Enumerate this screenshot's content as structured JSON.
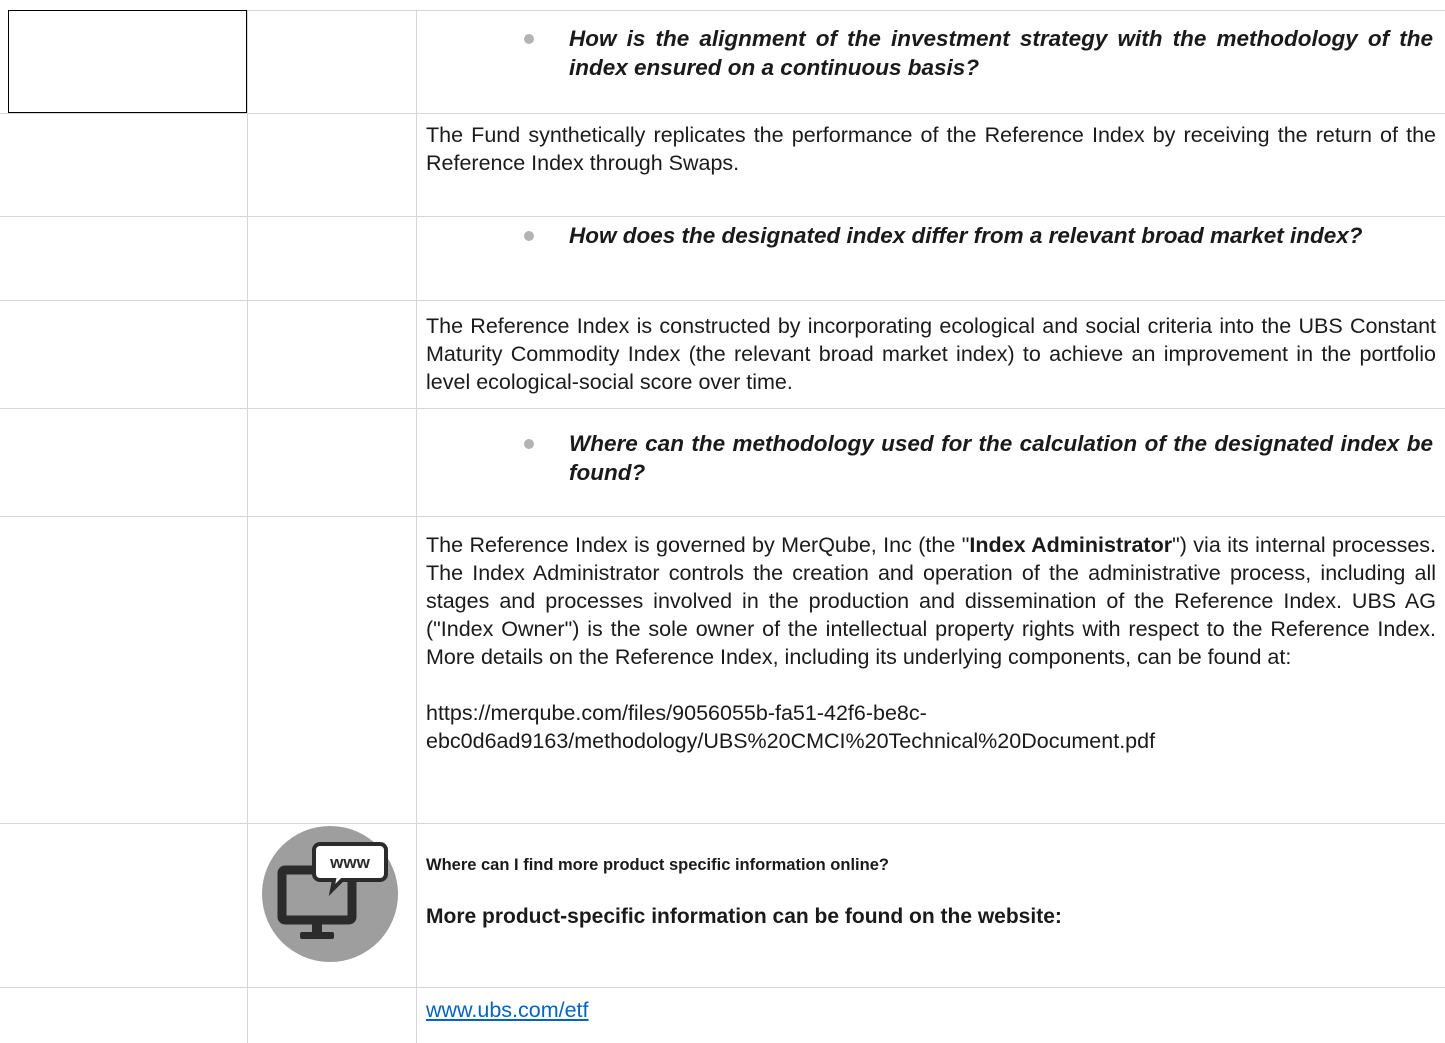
{
  "sections": [
    {
      "question": "How is the alignment of the investment strategy with the methodology of the index ensured on a continuous basis?",
      "answer": "The Fund synthetically replicates the performance of the Reference Index by receiving the return of the Reference Index through Swaps."
    },
    {
      "question": "How does the designated index differ from a relevant broad market index?",
      "answer": "The Reference Index is constructed by incorporating ecological and social criteria into the UBS Constant Maturity Commodity Index (the relevant broad market index) to achieve an improvement in the portfolio level ecological-social score over time."
    },
    {
      "question": "Where can the methodology used for the calculation of the designated index be found?",
      "answer_part1": "The Reference Index is governed by MerQube, Inc (the \"",
      "answer_bold": "Index Administrator",
      "answer_part2": "\") via its internal processes. The Index Administrator controls the creation and operation of the administrative process, including all stages and processes involved in the production and dissemination of the Reference Index. UBS AG (\"Index Owner\") is the sole owner of the intellectual property rights with respect to the Reference Index. More details on the Reference Index, including its underlying components, can be found at:",
      "url_line1": "https://merqube.com/files/9056055b-fa51-42f6-be8c-",
      "url_line2": "ebc0d6ad9163/methodology/UBS%20CMCI%20Technical%20Document.pdf"
    }
  ],
  "online_info": {
    "icon": "www-monitor-icon",
    "icon_label": "www",
    "heading": "Where can I find more product specific information online?",
    "subheading": "More product-specific information can be found on the website:",
    "link_text": "www.ubs.com/etf"
  },
  "colors": {
    "grid": "#d6d6d6",
    "bullet": "#b3b3b3",
    "icon_circle": "#9e9e9e",
    "link": "#0563c1"
  }
}
